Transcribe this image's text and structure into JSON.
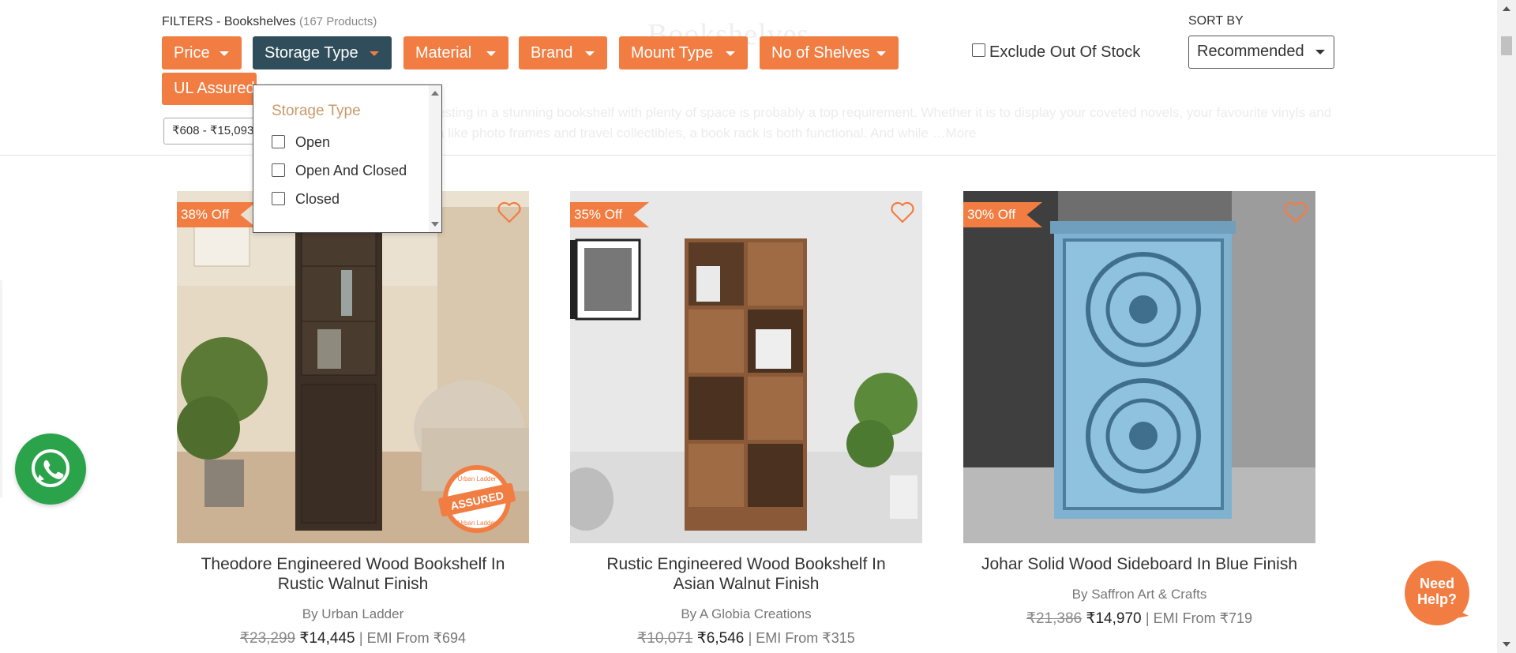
{
  "filters": {
    "heading": "FILTERS - Bookshelves",
    "count": "(167 Products)",
    "buttons": [
      {
        "label": "Price"
      },
      {
        "label": "Storage Type"
      },
      {
        "label": "Material"
      },
      {
        "label": "Brand"
      },
      {
        "label": "Mount Type"
      },
      {
        "label": "No of Shelves"
      }
    ],
    "ul_assured_label": "UL Assured",
    "price_chip": "₹608 - ₹15,093",
    "exclude_label": "Exclude Out Of Stock",
    "exclude_checked": false
  },
  "sort": {
    "label": "SORT BY",
    "selected": "Recommended"
  },
  "background": {
    "title": "Bookshelves",
    "description": "…when investing in a stunning bookshelf with plenty of space is probably a top requirement. Whether it is to display your coveted novels, your favourite vinyls and memorabilia like photo frames and travel collectibles, a book rack is both functional. And while …More"
  },
  "dropdown": {
    "title": "Storage Type",
    "options": [
      "Open",
      "Open And Closed",
      "Closed"
    ]
  },
  "products": [
    {
      "discount": "38% Off",
      "name_line1": "Theodore Engineered Wood Bookshelf In",
      "name_line2": "Rustic Walnut Finish",
      "brand": "By Urban Ladder",
      "old_price": "₹23,299",
      "price": "₹14,445",
      "emi": "| EMI From ₹694",
      "assured_text": "ASSURED",
      "assured_ring": "Urban Ladder"
    },
    {
      "discount": "35% Off",
      "name_line1": "Rustic Engineered Wood Bookshelf In",
      "name_line2": "Asian Walnut Finish",
      "brand": "By A Globia Creations",
      "old_price": "₹10,071",
      "price": "₹6,546",
      "emi": "| EMI From ₹315"
    },
    {
      "discount": "30% Off",
      "name_line1": "Johar Solid Wood Sideboard In Blue Finish",
      "name_line2": "",
      "brand": "By Saffron Art & Crafts",
      "old_price": "₹21,386",
      "price": "₹14,970",
      "emi": "| EMI From ₹719"
    }
  ],
  "help": {
    "line1": "Need",
    "line2": "Help?"
  },
  "colors": {
    "accent": "#f27d42",
    "active": "#2f4d5a",
    "whatsapp": "#2aa34a"
  }
}
